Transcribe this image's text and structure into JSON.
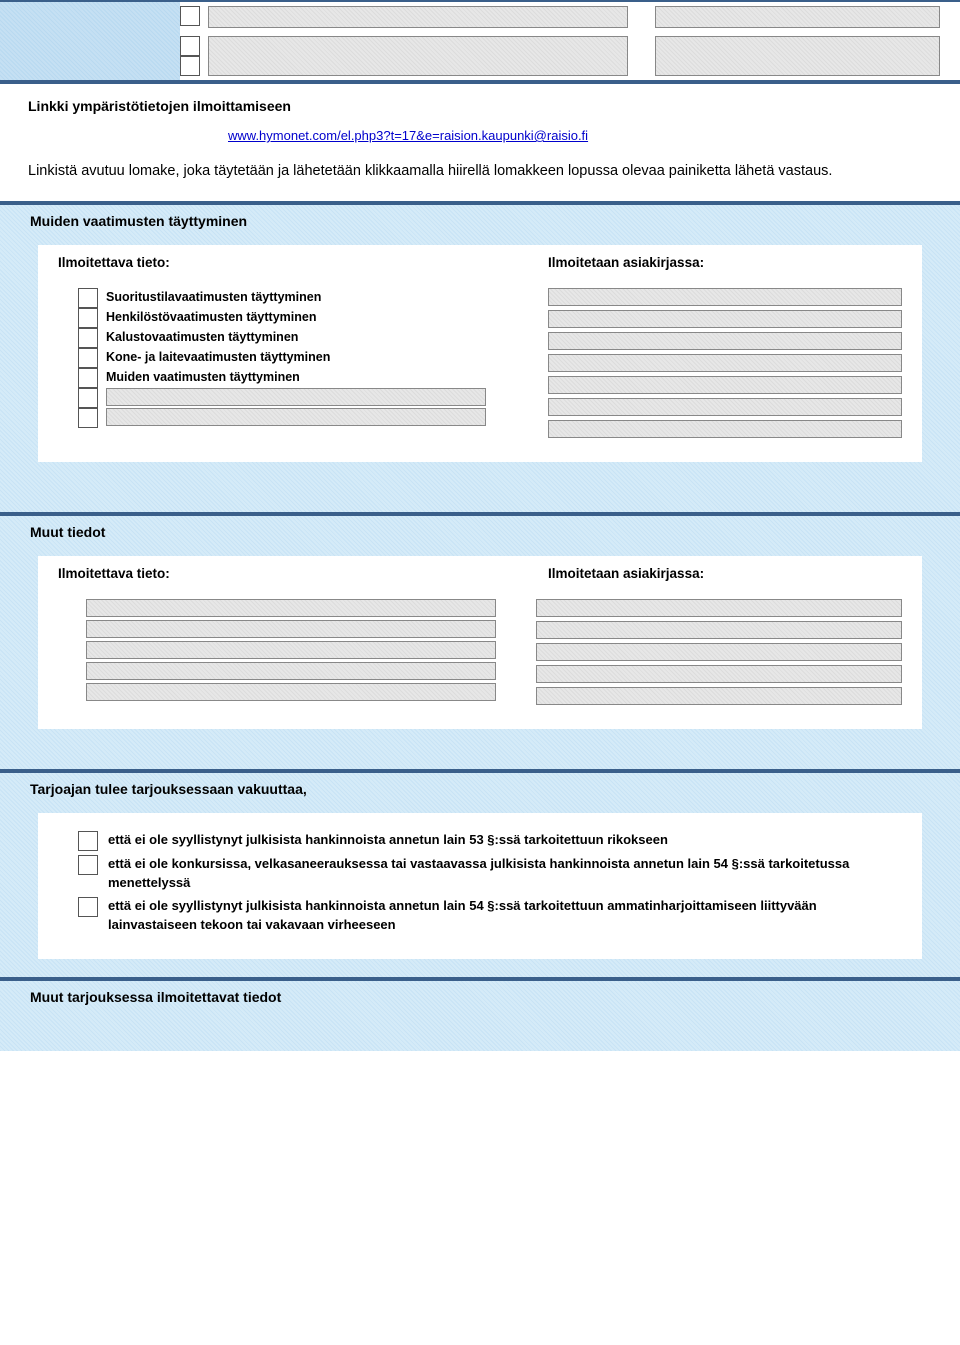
{
  "section_link": {
    "title": "Linkki ympäristötietojen ilmoittamiseen",
    "url": "www.hymonet.com/el.php3?t=17&e=raision.kaupunki@raisio.fi",
    "paragraph": "Linkistä avutuu lomake, joka täytetään ja lähetetään klikkaamalla hiirellä lomakkeen lopussa olevaa painiketta lähetä vastaus."
  },
  "sec_muiden": {
    "title": "Muiden vaatimusten täyttyminen",
    "col_left": "Ilmoitettava tieto:",
    "col_right": "Ilmoitetaan asiakirjassa:",
    "items": [
      "Suoritustilavaatimusten täyttyminen",
      "Henkilöstövaatimusten täyttyminen",
      "Kalustovaatimusten täyttyminen",
      "Kone- ja laitevaatimusten täyttyminen",
      "Muiden vaatimusten täyttyminen"
    ]
  },
  "sec_muut": {
    "title": "Muut tiedot",
    "col_left": "Ilmoitettava tieto:",
    "col_right": "Ilmoitetaan asiakirjassa:"
  },
  "sec_vakuuttaa": {
    "title": "Tarjoajan tulee tarjouksessaan vakuuttaa,",
    "items": [
      "että ei ole syyllistynyt julkisista hankinnoista annetun lain 53 §:ssä tarkoitettuun rikokseen",
      "että ei ole konkursissa, velkasaneerauksessa tai vastaavassa julkisista hankinnoista annetun lain 54 §:ssä tarkoitetussa menettelyssä",
      "että ei ole syyllistynyt julkisista hankinnoista annetun lain 54 §:ssä tarkoitettuun ammatinharjoittamiseen liittyvään lainvastaiseen tekoon tai vakavaan virheeseen"
    ]
  },
  "sec_bottom": {
    "title": "Muut tarjouksessa ilmoitettavat tiedot"
  }
}
